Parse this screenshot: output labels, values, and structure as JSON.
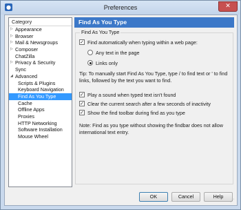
{
  "window": {
    "title": "Preferences",
    "app_icon": "firefox-app-icon",
    "close_icon": "close-icon"
  },
  "sidebar": {
    "header": "Category",
    "items": [
      {
        "label": "Appearance",
        "expander": "▷",
        "level": 0
      },
      {
        "label": "Browser",
        "expander": "▷",
        "level": 0
      },
      {
        "label": "Mail & Newsgroups",
        "expander": "▷",
        "level": 0
      },
      {
        "label": "Composer",
        "expander": "▷",
        "level": 0
      },
      {
        "label": "ChatZilla",
        "expander": "",
        "level": 0
      },
      {
        "label": "Privacy & Security",
        "expander": "▷",
        "level": 0
      },
      {
        "label": "Sync",
        "expander": "",
        "level": 0
      },
      {
        "label": "Advanced",
        "expander": "◢",
        "level": 0
      },
      {
        "label": "Scripts & Plugins",
        "expander": "",
        "level": 1
      },
      {
        "label": "Keyboard Navigation",
        "expander": "",
        "level": 1
      },
      {
        "label": "Find As You Type",
        "expander": "",
        "level": 1,
        "selected": true
      },
      {
        "label": "Cache",
        "expander": "",
        "level": 1
      },
      {
        "label": "Offline Apps",
        "expander": "",
        "level": 1
      },
      {
        "label": "Proxies",
        "expander": "",
        "level": 1
      },
      {
        "label": "HTTP Networking",
        "expander": "",
        "level": 1
      },
      {
        "label": "Software Installation",
        "expander": "",
        "level": 1
      },
      {
        "label": "Mouse Wheel",
        "expander": "",
        "level": 1
      }
    ]
  },
  "panel": {
    "title": "Find As You Type",
    "group_label": "Find As You Type",
    "auto_find": {
      "label": "Find automatically when typing within a web page:",
      "checked": true
    },
    "radio_any_text": {
      "label": "Any text in the page",
      "selected": false
    },
    "radio_links_only": {
      "label": "Links only",
      "selected": true
    },
    "tip": "Tip: To manually start Find As You Type, type / to find text or ' to find links, followed by the text you want to find.",
    "play_sound": {
      "label": "Play a sound when typed text isn't found",
      "checked": true
    },
    "clear_search": {
      "label": "Clear the current search after a few seconds of inactivity",
      "checked": true
    },
    "show_toolbar": {
      "label": "Show the find toolbar during find as you type",
      "checked": true
    },
    "note": "Note: Find as you type without showing the findbar does not allow international text entry."
  },
  "buttons": {
    "ok": "OK",
    "cancel": "Cancel",
    "help": "Help"
  },
  "check_mark": "✓",
  "colors": {
    "selection": "#3399ff",
    "panel_header": "#3c78c8",
    "frame": "#c9d9ed"
  }
}
